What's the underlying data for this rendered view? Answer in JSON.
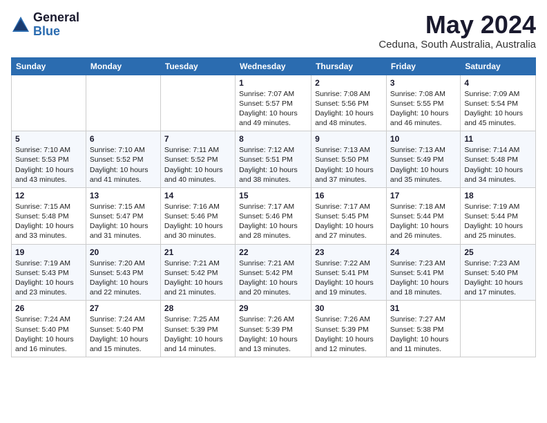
{
  "header": {
    "logo_general": "General",
    "logo_blue": "Blue",
    "title": "May 2024",
    "subtitle": "Ceduna, South Australia, Australia"
  },
  "days_of_week": [
    "Sunday",
    "Monday",
    "Tuesday",
    "Wednesday",
    "Thursday",
    "Friday",
    "Saturday"
  ],
  "weeks": [
    [
      {
        "day": "",
        "info": ""
      },
      {
        "day": "",
        "info": ""
      },
      {
        "day": "",
        "info": ""
      },
      {
        "day": "1",
        "info": "Sunrise: 7:07 AM\nSunset: 5:57 PM\nDaylight: 10 hours and 49 minutes."
      },
      {
        "day": "2",
        "info": "Sunrise: 7:08 AM\nSunset: 5:56 PM\nDaylight: 10 hours and 48 minutes."
      },
      {
        "day": "3",
        "info": "Sunrise: 7:08 AM\nSunset: 5:55 PM\nDaylight: 10 hours and 46 minutes."
      },
      {
        "day": "4",
        "info": "Sunrise: 7:09 AM\nSunset: 5:54 PM\nDaylight: 10 hours and 45 minutes."
      }
    ],
    [
      {
        "day": "5",
        "info": "Sunrise: 7:10 AM\nSunset: 5:53 PM\nDaylight: 10 hours and 43 minutes."
      },
      {
        "day": "6",
        "info": "Sunrise: 7:10 AM\nSunset: 5:52 PM\nDaylight: 10 hours and 41 minutes."
      },
      {
        "day": "7",
        "info": "Sunrise: 7:11 AM\nSunset: 5:52 PM\nDaylight: 10 hours and 40 minutes."
      },
      {
        "day": "8",
        "info": "Sunrise: 7:12 AM\nSunset: 5:51 PM\nDaylight: 10 hours and 38 minutes."
      },
      {
        "day": "9",
        "info": "Sunrise: 7:13 AM\nSunset: 5:50 PM\nDaylight: 10 hours and 37 minutes."
      },
      {
        "day": "10",
        "info": "Sunrise: 7:13 AM\nSunset: 5:49 PM\nDaylight: 10 hours and 35 minutes."
      },
      {
        "day": "11",
        "info": "Sunrise: 7:14 AM\nSunset: 5:48 PM\nDaylight: 10 hours and 34 minutes."
      }
    ],
    [
      {
        "day": "12",
        "info": "Sunrise: 7:15 AM\nSunset: 5:48 PM\nDaylight: 10 hours and 33 minutes."
      },
      {
        "day": "13",
        "info": "Sunrise: 7:15 AM\nSunset: 5:47 PM\nDaylight: 10 hours and 31 minutes."
      },
      {
        "day": "14",
        "info": "Sunrise: 7:16 AM\nSunset: 5:46 PM\nDaylight: 10 hours and 30 minutes."
      },
      {
        "day": "15",
        "info": "Sunrise: 7:17 AM\nSunset: 5:46 PM\nDaylight: 10 hours and 28 minutes."
      },
      {
        "day": "16",
        "info": "Sunrise: 7:17 AM\nSunset: 5:45 PM\nDaylight: 10 hours and 27 minutes."
      },
      {
        "day": "17",
        "info": "Sunrise: 7:18 AM\nSunset: 5:44 PM\nDaylight: 10 hours and 26 minutes."
      },
      {
        "day": "18",
        "info": "Sunrise: 7:19 AM\nSunset: 5:44 PM\nDaylight: 10 hours and 25 minutes."
      }
    ],
    [
      {
        "day": "19",
        "info": "Sunrise: 7:19 AM\nSunset: 5:43 PM\nDaylight: 10 hours and 23 minutes."
      },
      {
        "day": "20",
        "info": "Sunrise: 7:20 AM\nSunset: 5:43 PM\nDaylight: 10 hours and 22 minutes."
      },
      {
        "day": "21",
        "info": "Sunrise: 7:21 AM\nSunset: 5:42 PM\nDaylight: 10 hours and 21 minutes."
      },
      {
        "day": "22",
        "info": "Sunrise: 7:21 AM\nSunset: 5:42 PM\nDaylight: 10 hours and 20 minutes."
      },
      {
        "day": "23",
        "info": "Sunrise: 7:22 AM\nSunset: 5:41 PM\nDaylight: 10 hours and 19 minutes."
      },
      {
        "day": "24",
        "info": "Sunrise: 7:23 AM\nSunset: 5:41 PM\nDaylight: 10 hours and 18 minutes."
      },
      {
        "day": "25",
        "info": "Sunrise: 7:23 AM\nSunset: 5:40 PM\nDaylight: 10 hours and 17 minutes."
      }
    ],
    [
      {
        "day": "26",
        "info": "Sunrise: 7:24 AM\nSunset: 5:40 PM\nDaylight: 10 hours and 16 minutes."
      },
      {
        "day": "27",
        "info": "Sunrise: 7:24 AM\nSunset: 5:40 PM\nDaylight: 10 hours and 15 minutes."
      },
      {
        "day": "28",
        "info": "Sunrise: 7:25 AM\nSunset: 5:39 PM\nDaylight: 10 hours and 14 minutes."
      },
      {
        "day": "29",
        "info": "Sunrise: 7:26 AM\nSunset: 5:39 PM\nDaylight: 10 hours and 13 minutes."
      },
      {
        "day": "30",
        "info": "Sunrise: 7:26 AM\nSunset: 5:39 PM\nDaylight: 10 hours and 12 minutes."
      },
      {
        "day": "31",
        "info": "Sunrise: 7:27 AM\nSunset: 5:38 PM\nDaylight: 10 hours and 11 minutes."
      },
      {
        "day": "",
        "info": ""
      }
    ]
  ]
}
